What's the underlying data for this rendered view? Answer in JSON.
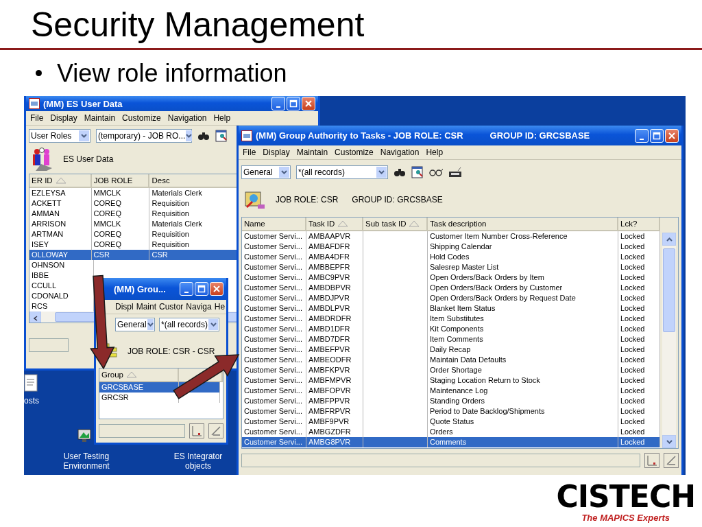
{
  "slide": {
    "title": "Security Management",
    "bullets": [
      "View role information"
    ]
  },
  "user_data_window": {
    "title": "(MM) ES User Data",
    "menu": [
      "File",
      "Display",
      "Maintain",
      "Customize",
      "Navigation",
      "Help"
    ],
    "dropdowns": [
      {
        "value": "User Roles"
      },
      {
        "value": "(temporary) - JOB RO..."
      }
    ],
    "header": "ES User Data",
    "columns": [
      {
        "label": "ER ID",
        "sorted": true
      },
      {
        "label": "JOB ROLE",
        "sorted": false
      },
      {
        "label": "Desc",
        "sorted": false
      }
    ],
    "rows": [
      {
        "user_id": "EZLEYSA",
        "job_role": "MMCLK",
        "desc": "Materials Clerk",
        "selected": false
      },
      {
        "user_id": "ACKETT",
        "job_role": "COREQ",
        "desc": "Requisition",
        "selected": false
      },
      {
        "user_id": "AMMAN",
        "job_role": "COREQ",
        "desc": "Requisition",
        "selected": false
      },
      {
        "user_id": "ARRISON",
        "job_role": "MMCLK",
        "desc": "Materials Clerk",
        "selected": false
      },
      {
        "user_id": "ARTMAN",
        "job_role": "COREQ",
        "desc": "Requisition",
        "selected": false
      },
      {
        "user_id": "ISEY",
        "job_role": "COREQ",
        "desc": "Requisition",
        "selected": false
      },
      {
        "user_id": "OLLOWAY",
        "job_role": "CSR",
        "desc": "CSR",
        "selected": true
      },
      {
        "user_id": "OHNSON",
        "selected": false
      },
      {
        "user_id": "IBBE",
        "selected": false
      },
      {
        "user_id": "CCULL",
        "selected": false
      },
      {
        "user_id": "CDONALD",
        "selected": false
      },
      {
        "user_id": "RCS",
        "selected": false
      }
    ]
  },
  "group_window": {
    "title": "(MM) Grou...",
    "menu": [
      "Displ",
      "Maint",
      "Custor",
      "Naviga",
      "He"
    ],
    "dropdowns": [
      {
        "value": "General"
      },
      {
        "value": "*(all records)"
      }
    ],
    "header": "JOB ROLE: CSR - CSR",
    "columns": [
      {
        "label": "Group",
        "sorted": true
      }
    ],
    "rows": [
      {
        "group": "GRCSBASE",
        "selected": true
      },
      {
        "group": "GRCSR",
        "selected": false
      }
    ]
  },
  "tasks_window": {
    "title": "(MM) Group Authority to Tasks - JOB ROLE: CSR",
    "title_extra": "GROUP ID: GRCSBASE",
    "menu": [
      "File",
      "Display",
      "Maintain",
      "Customize",
      "Navigation",
      "Help"
    ],
    "dropdowns": [
      {
        "value": "General"
      },
      {
        "value": "*(all records)"
      }
    ],
    "header": [
      "JOB ROLE: CSR",
      "GROUP ID: GRCSBASE"
    ],
    "columns": [
      {
        "label": "Name",
        "sorted": false
      },
      {
        "label": "Task ID",
        "sorted": true
      },
      {
        "label": "Sub task ID",
        "sorted": true
      },
      {
        "label": "Task description",
        "sorted": false
      },
      {
        "label": "Lck?",
        "sorted": false
      }
    ],
    "rows": [
      {
        "name": "Customer Servi...",
        "task_id": "AMBAAPVR",
        "task_description": "Customer Item Number Cross-Reference",
        "lck": "Locked",
        "selected": false
      },
      {
        "name": "Customer Servi...",
        "task_id": "AMBAFDFR",
        "task_description": "Shipping Calendar",
        "lck": "Locked",
        "selected": false
      },
      {
        "name": "Customer Servi...",
        "task_id": "AMBA4DFR",
        "task_description": "Hold Codes",
        "lck": "Locked",
        "selected": false
      },
      {
        "name": "Customer Servi...",
        "task_id": "AMBBEPFR",
        "task_description": "Salesrep Master List",
        "lck": "Locked",
        "selected": false
      },
      {
        "name": "Customer Servi...",
        "task_id": "AMBC9PVR",
        "task_description": "Open Orders/Back Orders by Item",
        "lck": "Locked",
        "selected": false
      },
      {
        "name": "Customer Servi...",
        "task_id": "AMBDBPVR",
        "task_description": "Open Orders/Back Orders by Customer",
        "lck": "Locked",
        "selected": false
      },
      {
        "name": "Customer Servi...",
        "task_id": "AMBDJPVR",
        "task_description": "Open Orders/Back Orders by Request Date",
        "lck": "Locked",
        "selected": false
      },
      {
        "name": "Customer Servi...",
        "task_id": "AMBDLPVR",
        "task_description": "Blanket Item Status",
        "lck": "Locked",
        "selected": false
      },
      {
        "name": "Customer Servi...",
        "task_id": "AMBDRDFR",
        "task_description": "Item Substitutes",
        "lck": "Locked",
        "selected": false
      },
      {
        "name": "Customer Servi...",
        "task_id": "AMBD1DFR",
        "task_description": "Kit Components",
        "lck": "Locked",
        "selected": false
      },
      {
        "name": "Customer Servi...",
        "task_id": "AMBD7DFR",
        "task_description": "Item Comments",
        "lck": "Locked",
        "selected": false
      },
      {
        "name": "Customer Servi...",
        "task_id": "AMBEFPVR",
        "task_description": "Daily Recap",
        "lck": "Locked",
        "selected": false
      },
      {
        "name": "Customer Servi...",
        "task_id": "AMBEODFR",
        "task_description": "Maintain Data Defaults",
        "lck": "Locked",
        "selected": false
      },
      {
        "name": "Customer Servi...",
        "task_id": "AMBFKPVR",
        "task_description": "Order Shortage",
        "lck": "Locked",
        "selected": false
      },
      {
        "name": "Customer Servi...",
        "task_id": "AMBFMPVR",
        "task_description": "Staging Location Return to Stock",
        "lck": "Locked",
        "selected": false
      },
      {
        "name": "Customer Servi...",
        "task_id": "AMBFOPVR",
        "task_description": "Maintenance Log",
        "lck": "Locked",
        "selected": false
      },
      {
        "name": "Customer Servi...",
        "task_id": "AMBFPPVR",
        "task_description": "Standing Orders",
        "lck": "Locked",
        "selected": false
      },
      {
        "name": "Customer Servi...",
        "task_id": "AMBFRPVR",
        "task_description": "Period to Date Backlog/Shipments",
        "lck": "Locked",
        "selected": false
      },
      {
        "name": "Customer Servi...",
        "task_id": "AMBF9PVR",
        "task_description": "Quote Status",
        "lck": "Locked",
        "selected": false
      },
      {
        "name": "Customer Servi...",
        "task_id": "AMBGZDFR",
        "task_description": "Orders",
        "lck": "Locked",
        "selected": false
      },
      {
        "name": "Customer Servi...",
        "task_id": "AMBG8PVR",
        "task_description": "Comments",
        "lck": "Locked",
        "selected": true
      }
    ]
  },
  "desktop_icons": [
    {
      "label": "osts"
    },
    {
      "label": "User Testing Environment"
    },
    {
      "label": "ES Integrator objects"
    }
  ],
  "logo": {
    "name": "CISTECH",
    "tagline": "The MAPICS Experts"
  }
}
